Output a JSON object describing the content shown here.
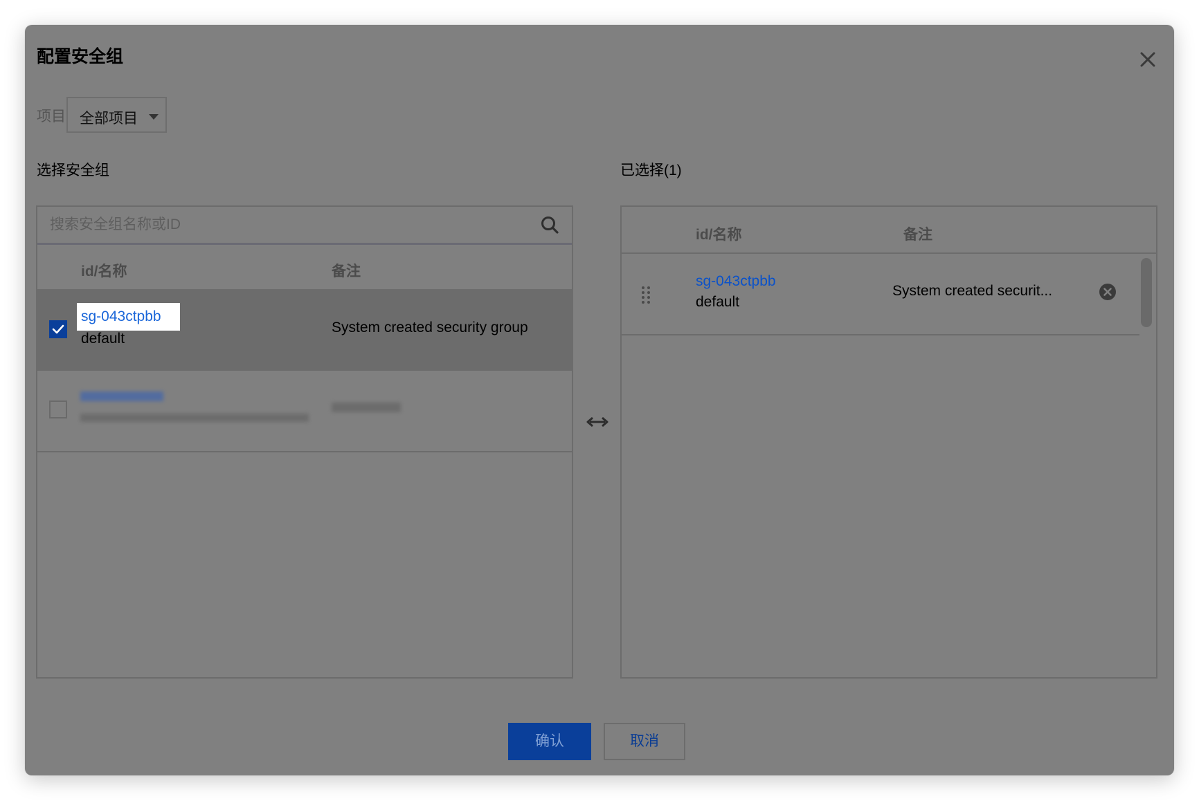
{
  "dialog": {
    "title": "配置安全组",
    "close_icon": "close-icon"
  },
  "project": {
    "label": "项目",
    "selected": "全部项目"
  },
  "left": {
    "label": "选择安全组",
    "search_placeholder": "搜索安全组名称或ID",
    "columns": [
      "id/名称",
      "备注"
    ],
    "rows": [
      {
        "id": "sg-043ctpbb",
        "name": "default",
        "remark": "System created security group",
        "checked": true
      }
    ]
  },
  "right": {
    "label": "已选择(1)",
    "columns": [
      "id/名称",
      "备注"
    ],
    "rows": [
      {
        "id": "sg-043ctpbb",
        "name": "default",
        "remark": "System created securit..."
      }
    ]
  },
  "buttons": {
    "confirm": "确认",
    "cancel": "取消"
  },
  "colors": {
    "overlay": "#808080",
    "primary": "#0a3f9a",
    "link": "#0b52c9"
  }
}
